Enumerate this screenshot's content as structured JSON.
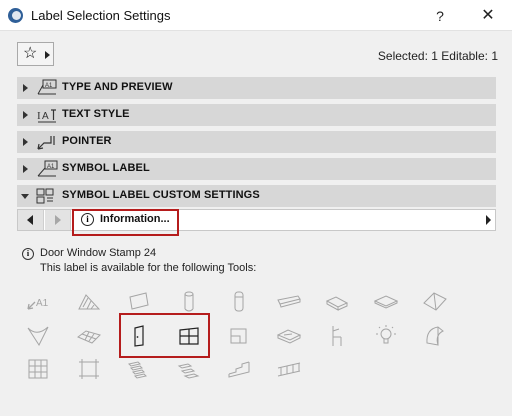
{
  "window": {
    "title": "Label Selection Settings",
    "help_label": "?",
    "close_label": "✕"
  },
  "toolbar": {
    "favorites_icon": "star-icon",
    "selected_info": "Selected: 1 Editable: 1"
  },
  "panels": [
    {
      "label": "TYPE AND PREVIEW",
      "expanded": false,
      "icon": "type-preview-icon"
    },
    {
      "label": "TEXT STYLE",
      "expanded": false,
      "icon": "text-style-icon"
    },
    {
      "label": "POINTER",
      "expanded": false,
      "icon": "pointer-icon"
    },
    {
      "label": "SYMBOL LABEL",
      "expanded": false,
      "icon": "symbol-label-icon"
    },
    {
      "label": "SYMBOL LABEL CUSTOM SETTINGS",
      "expanded": true,
      "icon": "custom-settings-icon"
    }
  ],
  "custom_settings": {
    "page_label": "Information...",
    "label_name": "Door Window Stamp 24",
    "tools_text": "This label is available for the following Tools:"
  },
  "tools": [
    {
      "name": "text-label-tool-icon",
      "enabled": false
    },
    {
      "name": "fill-tool-icon",
      "enabled": false
    },
    {
      "name": "wall-tool-icon",
      "enabled": false
    },
    {
      "name": "column-tool-icon",
      "enabled": false
    },
    {
      "name": "column-alt-tool-icon",
      "enabled": false
    },
    {
      "name": "beam-tool-icon",
      "enabled": false
    },
    {
      "name": "stair-flight-tool-icon",
      "enabled": false
    },
    {
      "name": "slab-tool-icon",
      "enabled": false
    },
    {
      "name": "roof-tool-icon",
      "enabled": false
    },
    {
      "name": "shell-tool-icon",
      "enabled": false
    },
    {
      "name": "mesh-tool-icon",
      "enabled": false
    },
    {
      "name": "door-tool-icon",
      "enabled": true
    },
    {
      "name": "window-tool-icon",
      "enabled": true
    },
    {
      "name": "skylight-tool-icon",
      "enabled": false
    },
    {
      "name": "zone-tool-icon",
      "enabled": false
    },
    {
      "name": "object-tool-icon",
      "enabled": false
    },
    {
      "name": "lamp-tool-icon",
      "enabled": false
    },
    {
      "name": "morph-tool-icon",
      "enabled": false
    },
    {
      "name": "curtain-wall-tool-icon",
      "enabled": false
    },
    {
      "name": "frame-tool-icon",
      "enabled": false
    },
    {
      "name": "stair-tool-icon",
      "enabled": false
    },
    {
      "name": "landing-tool-icon",
      "enabled": false
    },
    {
      "name": "riser-tool-icon",
      "enabled": false
    },
    {
      "name": "railing-tool-icon",
      "enabled": false
    }
  ],
  "colors": {
    "highlight": "#b51c1c",
    "panel_bg": "#d7d7d7",
    "disabled_icon": "#a5a5a5",
    "enabled_icon": "#222222"
  }
}
